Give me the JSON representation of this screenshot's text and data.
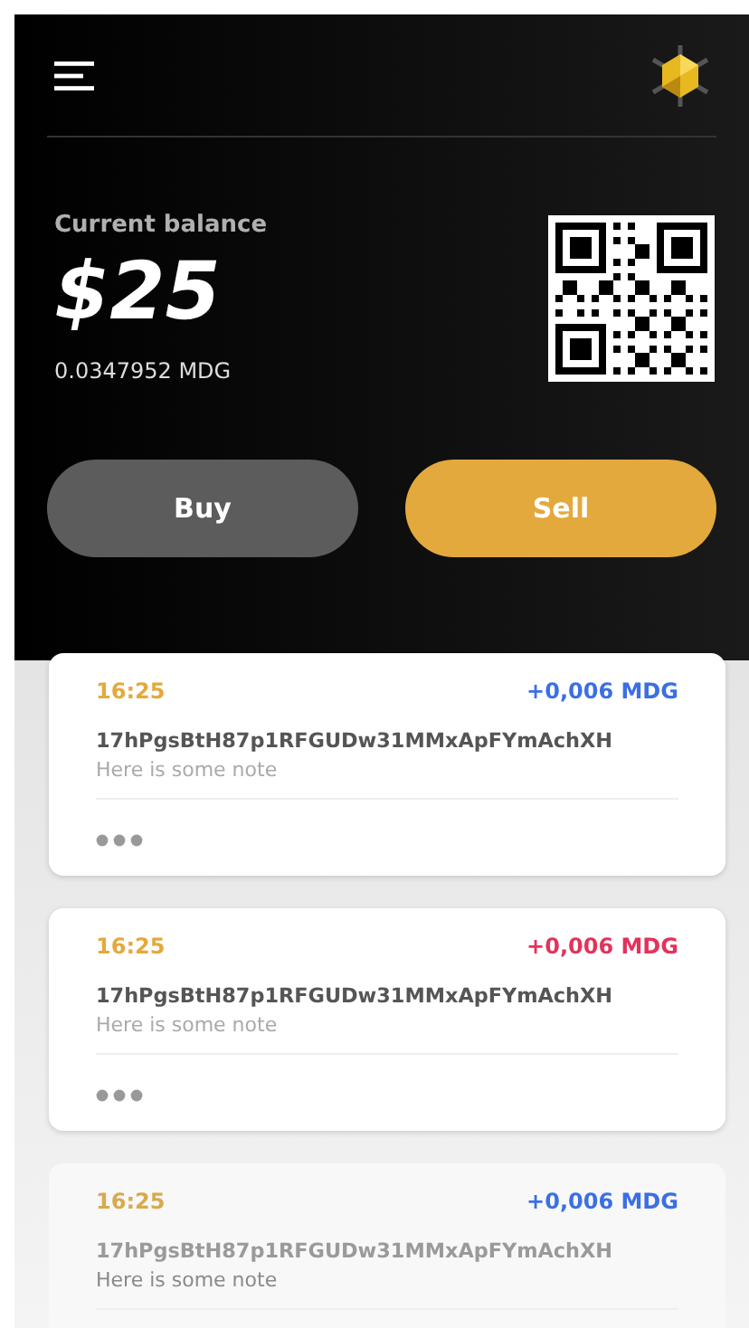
{
  "balance": {
    "label": "Current balance",
    "amount": "$25",
    "crypto": "0.0347952 MDG"
  },
  "buttons": [
    {
      "label": "Buy",
      "kind": "secondary"
    },
    {
      "label": "Sell",
      "kind": "primary"
    }
  ],
  "transactions": [
    {
      "time": "16:25",
      "amount": "+0,006 MDG",
      "color": "#3b6fe3",
      "address": "17hPgsBtH87p1RFGUDw31MMxApFYmAchXH",
      "note": "Here is some note",
      "faded": false
    },
    {
      "time": "16:25",
      "amount": "+0,006 MDG",
      "color": "#e2335c",
      "address": "17hPgsBtH87p1RFGUDw31MMxApFYmAchXH",
      "note": "Here is some note",
      "faded": false
    },
    {
      "time": "16:25",
      "amount": "+0,006 MDG",
      "color": "#3b6fe3",
      "address": "17hPgsBtH87p1RFGUDw31MMxApFYmAchXH",
      "note": "Here is some note",
      "faded": true
    }
  ]
}
